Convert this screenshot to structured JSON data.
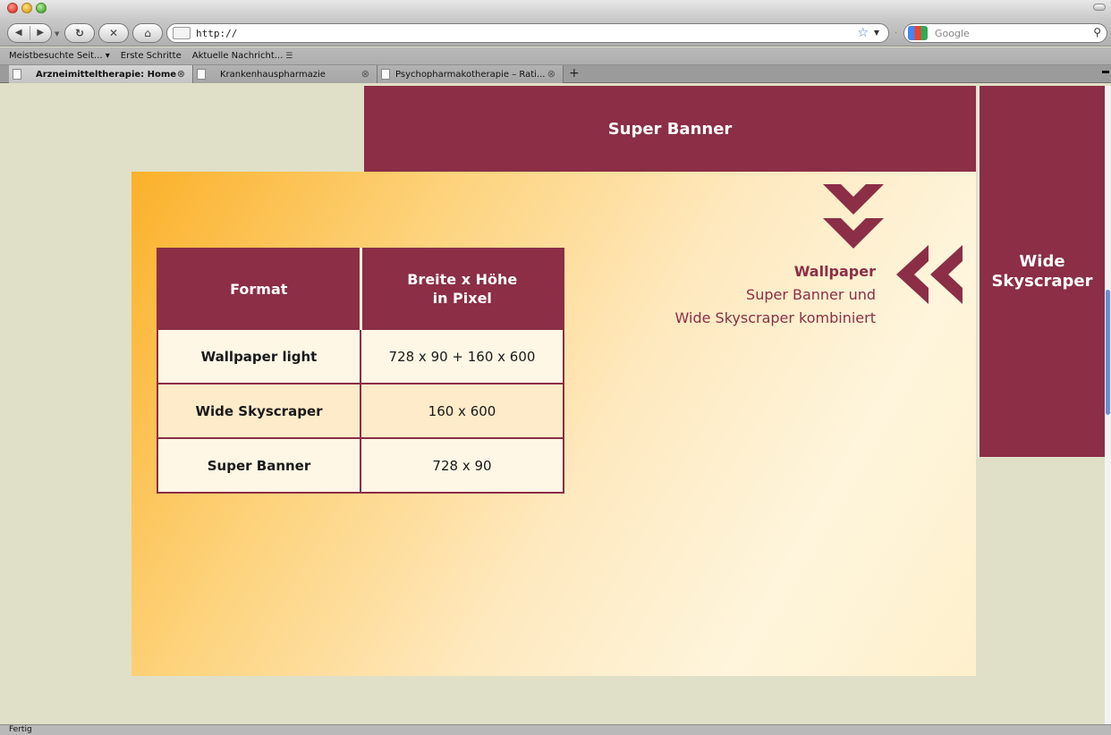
{
  "browser": {
    "url": "http://",
    "search_placeholder": "Google",
    "bookmarks": [
      "Meistbesuchte Seit... ▾",
      "Erste Schritte",
      "Aktuelle Nachricht..."
    ],
    "tabs": [
      {
        "label": "Arzneimitteltherapie: Home"
      },
      {
        "label": "Krankenhauspharmazie"
      },
      {
        "label": "Psychopharmakotherapie – Rati..."
      }
    ],
    "status": "Fertig"
  },
  "ad_layout": {
    "super_banner": "Super Banner",
    "wide_skyscraper": {
      "line1": "Wide",
      "line2": "Skyscraper"
    },
    "wallpaper_title": "Wallpaper",
    "wallpaper_line1": "Super Banner und",
    "wallpaper_line2": "Wide Skyscraper kombiniert",
    "accent_color": "#8b2e46"
  },
  "format_table": {
    "headers": {
      "format": "Format",
      "size_line1": "Breite x Höhe",
      "size_line2": "in Pixel"
    },
    "rows": [
      {
        "format": "Wallpaper light",
        "size": "728 x 90 + 160 x 600"
      },
      {
        "format": "Wide Skyscraper",
        "size": "160 x 600"
      },
      {
        "format": "Super Banner",
        "size": "728 x 90"
      }
    ]
  }
}
